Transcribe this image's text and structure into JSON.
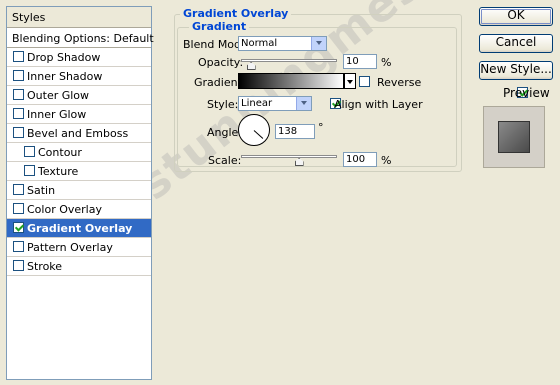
{
  "styles_panel": {
    "title": "Styles",
    "blending_options": "Blending Options: Default",
    "items": [
      {
        "label": "Drop Shadow",
        "checked": false,
        "sub": false
      },
      {
        "label": "Inner Shadow",
        "checked": false,
        "sub": false
      },
      {
        "label": "Outer Glow",
        "checked": false,
        "sub": false
      },
      {
        "label": "Inner Glow",
        "checked": false,
        "sub": false
      },
      {
        "label": "Bevel and Emboss",
        "checked": false,
        "sub": false
      },
      {
        "label": "Contour",
        "checked": false,
        "sub": true
      },
      {
        "label": "Texture",
        "checked": false,
        "sub": true
      },
      {
        "label": "Satin",
        "checked": false,
        "sub": false
      },
      {
        "label": "Color Overlay",
        "checked": false,
        "sub": false
      },
      {
        "label": "Gradient Overlay",
        "checked": true,
        "sub": false,
        "selected": true
      },
      {
        "label": "Pattern Overlay",
        "checked": false,
        "sub": false
      },
      {
        "label": "Stroke",
        "checked": false,
        "sub": false
      }
    ]
  },
  "gradient_overlay": {
    "group_title": "Gradient Overlay",
    "sub_title": "Gradient",
    "blend_mode_label": "Blend Mode:",
    "blend_mode_value": "Normal",
    "opacity_label": "Opacity:",
    "opacity_value": "10",
    "opacity_percent": 10,
    "percent_sign": "%",
    "gradient_label": "Gradient:",
    "reverse_label": "Reverse",
    "reverse_checked": false,
    "style_label": "Style:",
    "style_value": "Linear",
    "align_label": "Align with Layer",
    "align_checked": true,
    "angle_label": "Angle:",
    "angle_value": "138",
    "degree_sign": "°",
    "scale_label": "Scale:",
    "scale_value": "100",
    "scale_percent": 100
  },
  "buttons": {
    "ok": "OK",
    "cancel": "Cancel",
    "new_style": "New Style..."
  },
  "preview": {
    "label": "Preview",
    "checked": true
  },
  "watermark": "stunningmesh.com",
  "colors": {
    "selection": "#316ac5",
    "group_title": "#0046d5",
    "dialog_bg": "#ece9d8"
  }
}
